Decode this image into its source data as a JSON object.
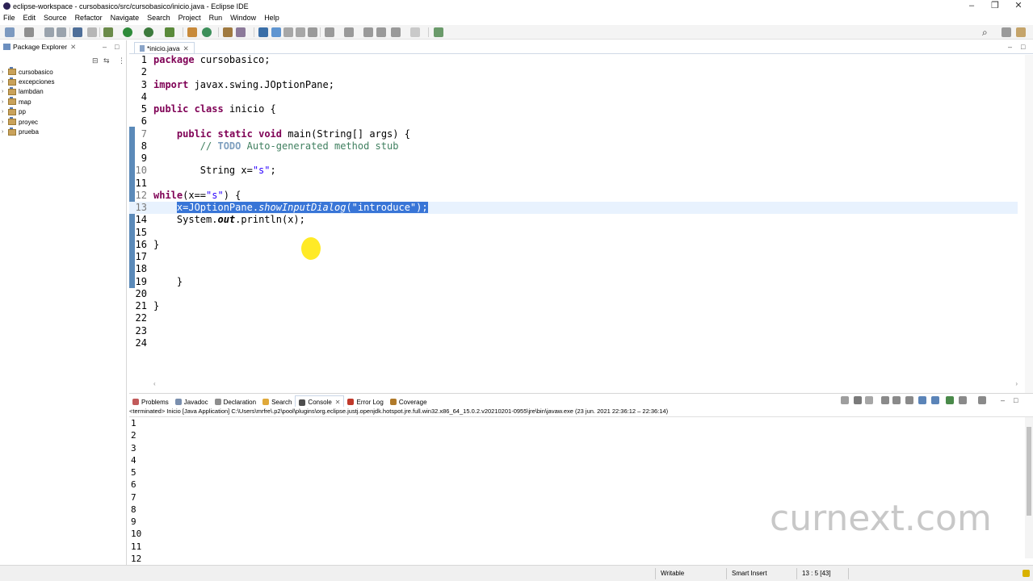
{
  "window": {
    "title": "eclipse-workspace - cursobasico/src/cursobasico/inicio.java - Eclipse IDE"
  },
  "menu": [
    "File",
    "Edit",
    "Source",
    "Refactor",
    "Navigate",
    "Search",
    "Project",
    "Run",
    "Window",
    "Help"
  ],
  "package_explorer": {
    "tab_label": "Package Explorer",
    "projects": [
      "cursobasico",
      "excepciones",
      "lambdan",
      "map",
      "pp",
      "proyec",
      "prueba"
    ]
  },
  "editor": {
    "tab_label": "*inicio.java",
    "cursor_line": 13,
    "lines": [
      {
        "n": "1",
        "html": "<span class='kw'>package</span> cursobasico;"
      },
      {
        "n": "2",
        "html": ""
      },
      {
        "n": "3",
        "html": "<span class='kw'>import</span> javax.swing.JOptionPane;"
      },
      {
        "n": "4",
        "html": ""
      },
      {
        "n": "5",
        "html": "<span class='kw'>public</span> <span class='kw'>class</span> inicio {"
      },
      {
        "n": "6",
        "html": ""
      },
      {
        "n": "7",
        "html": "    <span class='kw'>public</span> <span class='kw'>static</span> <span class='kw'>void</span> main(String[] args) {"
      },
      {
        "n": "8",
        "html": "        <span class='cm'>// </span><span class='todo'>TODO</span><span class='cm'> Auto-generated method stub</span>"
      },
      {
        "n": "9",
        "html": ""
      },
      {
        "n": "10",
        "html": "        String x=<span class='str'>\"s\"</span>;"
      },
      {
        "n": "11",
        "html": ""
      },
      {
        "n": "12",
        "html": "<span class='kw'>while</span>(x==<span class='str'>\"s\"</span>) {"
      },
      {
        "n": "13",
        "html": "    <span class='sel'>x=JOptionPane.<span class='it'>showInputDialog</span>(<span class='str'>\"introduce\"</span>);</span>"
      },
      {
        "n": "14",
        "html": "    System.<span class='itb'>out</span>.println(x);"
      },
      {
        "n": "15",
        "html": ""
      },
      {
        "n": "16",
        "html": "}"
      },
      {
        "n": "17",
        "html": ""
      },
      {
        "n": "18",
        "html": ""
      },
      {
        "n": "19",
        "html": "    }"
      },
      {
        "n": "20",
        "html": ""
      },
      {
        "n": "21",
        "html": "}"
      },
      {
        "n": "22",
        "html": ""
      },
      {
        "n": "23",
        "html": ""
      },
      {
        "n": "24",
        "html": ""
      }
    ]
  },
  "console_view": {
    "tabs": [
      {
        "label": "Problems",
        "color": "#c25a5a"
      },
      {
        "label": "Javadoc",
        "color": "#7a8fae"
      },
      {
        "label": "Declaration",
        "color": "#8e8e8e"
      },
      {
        "label": "Search",
        "color": "#e0a93a"
      },
      {
        "label": "Console",
        "color": "#4d4d4d",
        "active": true
      },
      {
        "label": "Error Log",
        "color": "#c0392b"
      },
      {
        "label": "Coverage",
        "color": "#b07a2a"
      }
    ],
    "description": "<terminated> Inicio [Java Application] C:\\Users\\mrfre\\.p2\\pool\\plugins\\org.eclipse.justj.openjdk.hotspot.jre.full.win32.x86_64_15.0.2.v20210201-0955\\jre\\bin\\javaw.exe  (23 jun. 2021 22:36:12 – 22:36:14)",
    "output": [
      "1",
      "2",
      "3",
      "4",
      "5",
      "6",
      "7",
      "8",
      "9",
      "10",
      "11",
      "12"
    ]
  },
  "watermark": "curnext.com",
  "status": {
    "writable": "Writable",
    "insert_mode": "Smart Insert",
    "position": "13 : 5 [43]"
  }
}
